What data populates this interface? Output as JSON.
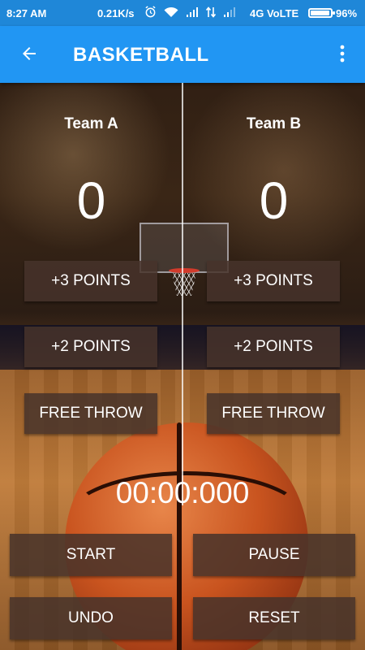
{
  "status_bar": {
    "time": "8:27 AM",
    "speed": "0.21K/s",
    "network": "4G VoLTE",
    "battery": "96%",
    "battery_level": 0.96
  },
  "app_bar": {
    "title": "BASKETBALL",
    "back_icon": "arrow-left-icon",
    "menu_icon": "more-vert-icon"
  },
  "team_a": {
    "name": "Team A",
    "score": "0",
    "plus3_label": "+3 POINTS",
    "plus2_label": "+2 POINTS",
    "free_throw_label": "FREE THROW"
  },
  "team_b": {
    "name": "Team B",
    "score": "0",
    "plus3_label": "+3 POINTS",
    "plus2_label": "+2 POINTS",
    "free_throw_label": "FREE THROW"
  },
  "timer": "00:00:000",
  "controls": {
    "start_label": "START",
    "pause_label": "PAUSE",
    "undo_label": "UNDO",
    "reset_label": "RESET"
  },
  "colors": {
    "status_bar": "#1f87d8",
    "app_bar": "#2196f3",
    "button_bg": "#46322a"
  }
}
